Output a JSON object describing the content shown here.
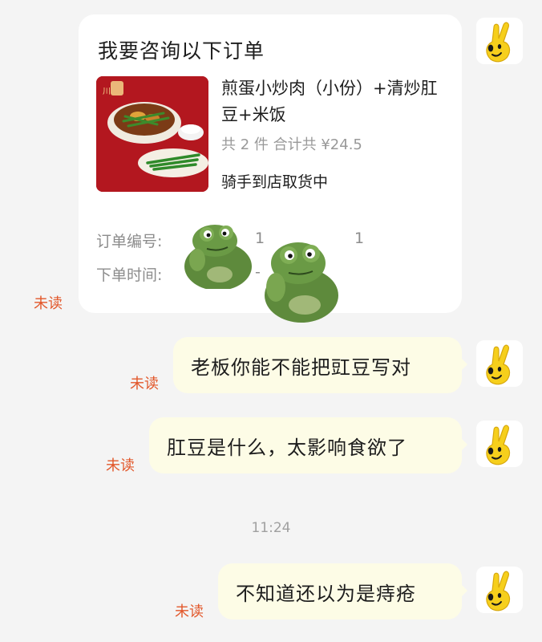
{
  "order_card": {
    "title": "我要咨询以下订单",
    "product_name": "煎蛋小炒肉（小份）+清炒肛豆+米饭",
    "summary": "共 2 件  合计共 ¥24.5",
    "status": "骑手到店取货中",
    "order_number_label": "订单编号:",
    "order_time_label": "下单时间:",
    "order_number_fragment_1": "1",
    "order_number_fragment_2": "1",
    "order_time_fragment": "-",
    "thumb_brand": "川"
  },
  "messages": [
    {
      "text": "老板你能不能把豇豆写对",
      "unread_label": "未读"
    },
    {
      "text": "肛豆是什么，太影响食欲了",
      "unread_label": "未读"
    },
    {
      "text": "不知道还以为是痔疮",
      "unread_label": "未读"
    }
  ],
  "card_unread_label": "未读",
  "timestamp": "11:24",
  "colors": {
    "background": "#f4f4f4",
    "bubble": "#fdfce6",
    "unread": "#e2572a",
    "avatar_hand": "#f6cf1c"
  },
  "icons": {
    "avatar": "yellow-peace-hand-icon",
    "sticker": "thinking-frog-sticker"
  }
}
